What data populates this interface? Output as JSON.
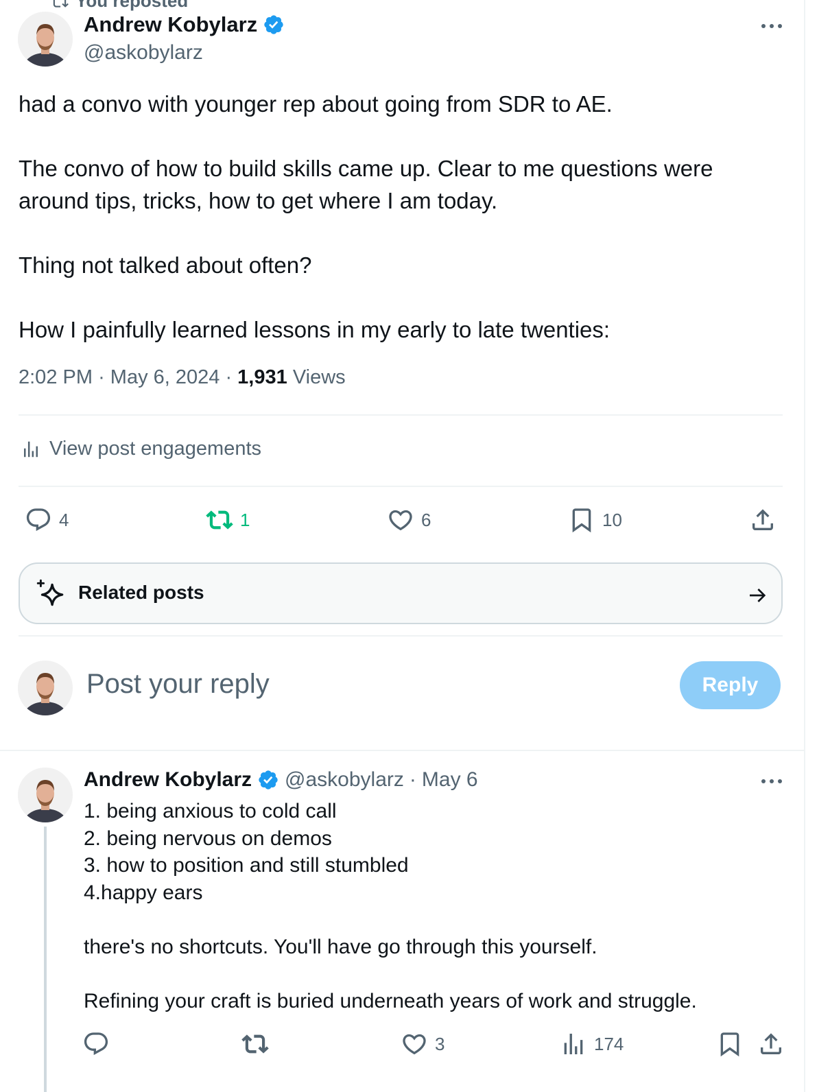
{
  "repost_banner": "You reposted",
  "main_post": {
    "author": {
      "name": "Andrew Kobylarz",
      "handle": "@askobylarz"
    },
    "text": "had a convo with younger rep about going from SDR to AE.\n\nThe convo of how to build skills came up. Clear to me questions were around tips, tricks, how to get where I am today.\n\nThing not talked about often?\n\nHow I painfully learned lessons in my early to late twenties:",
    "time": "2:02 PM",
    "date": "May 6, 2024",
    "views_count": "1,931",
    "views_label": "Views",
    "engagements_label": "View post engagements",
    "stats": {
      "replies": "4",
      "reposts": "1",
      "likes": "6",
      "bookmarks": "10"
    },
    "reposted_by_me": true
  },
  "related_posts_label": "Related posts",
  "reply_box": {
    "placeholder": "Post your reply",
    "button_label": "Reply"
  },
  "reply_post": {
    "author": {
      "name": "Andrew Kobylarz",
      "handle": "@askobylarz"
    },
    "date": "May 6",
    "text": "1. being anxious to cold call\n2. being nervous on demos\n3. how to position and still stumbled\n4.happy ears\n\nthere's no shortcuts. You'll have go through this yourself.\n\nRefining your craft is buried underneath years of work and struggle.",
    "stats": {
      "replies": "",
      "reposts": "",
      "likes": "3",
      "views": "174"
    }
  },
  "colors": {
    "accent": "#1d9bf0",
    "muted": "#536471",
    "repost_green": "#00ba7c",
    "reply_button": "#8ecdf8"
  }
}
